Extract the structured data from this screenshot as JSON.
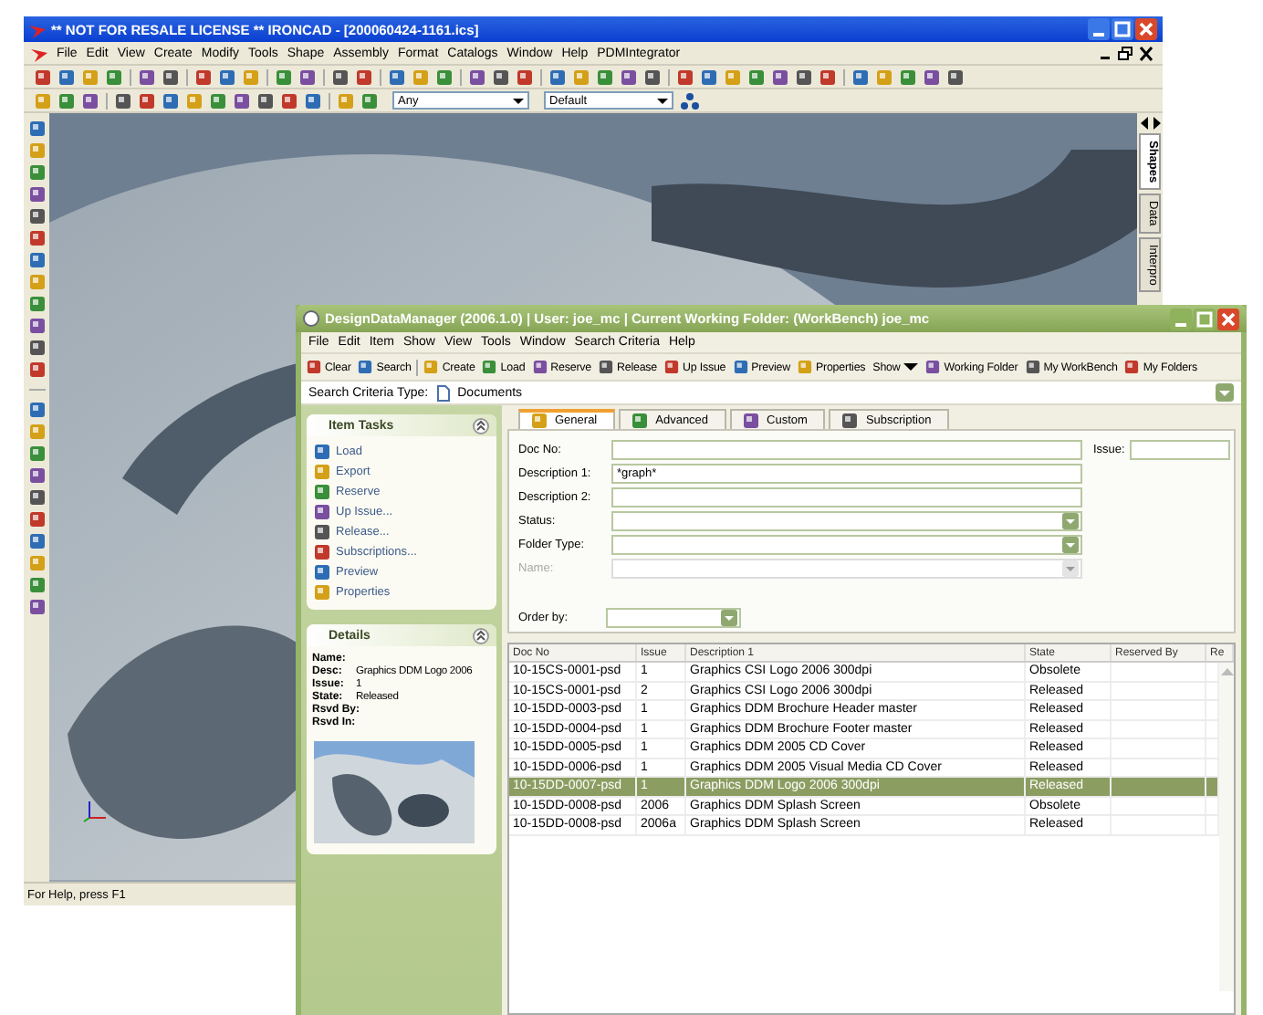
{
  "cad_window": {
    "title": "** NOT FOR RESALE LICENSE ** IRONCAD - [200060424-1161.ics]",
    "menu": [
      "File",
      "Edit",
      "View",
      "Create",
      "Modify",
      "Tools",
      "Shape",
      "Assembly",
      "Format",
      "Catalogs",
      "Window",
      "Help",
      "PDMIntegrator"
    ],
    "dropdowns": [
      {
        "value": "Any"
      },
      {
        "value": "Default"
      }
    ],
    "side_tabs": [
      {
        "label": "Shapes",
        "selected": true
      },
      {
        "label": "Data",
        "selected": false
      },
      {
        "label": "Interpro",
        "selected": false
      }
    ],
    "status_bar": "For Help, press F1"
  },
  "ddm_window": {
    "title": "DesignDataManager (2006.1.0) | User: joe_mc | Current Working Folder: (WorkBench) joe_mc",
    "menu": [
      "File",
      "Edit",
      "Item",
      "Show",
      "View",
      "Tools",
      "Window",
      "Search Criteria",
      "Help"
    ],
    "toolbar": [
      {
        "label": "Clear",
        "kind": "button"
      },
      {
        "label": "Search",
        "kind": "button"
      },
      {
        "label": "Create",
        "kind": "button"
      },
      {
        "label": "Load",
        "kind": "button"
      },
      {
        "label": "Reserve",
        "kind": "button"
      },
      {
        "label": "Release",
        "kind": "button"
      },
      {
        "label": "Up Issue",
        "kind": "button"
      },
      {
        "label": "Preview",
        "kind": "button"
      },
      {
        "label": "Properties",
        "kind": "button"
      },
      {
        "label": "Show",
        "kind": "menu"
      },
      {
        "label": "Working Folder",
        "kind": "button"
      },
      {
        "label": "My WorkBench",
        "kind": "button"
      },
      {
        "label": "My Folders",
        "kind": "button"
      }
    ],
    "search_criteria": {
      "label": "Search Criteria Type:",
      "value": "Documents"
    },
    "item_tasks": {
      "title": "Item Tasks",
      "items": [
        "Load",
        "Export",
        "Reserve",
        "Up Issue...",
        "Release...",
        "Subscriptions...",
        "Preview",
        "Properties"
      ]
    },
    "details": {
      "title": "Details",
      "fields": [
        {
          "label": "Name:"
        },
        {
          "label": "Desc:",
          "value": "Graphics DDM Logo 2006"
        },
        {
          "label": "Issue:",
          "value": "1"
        },
        {
          "label": "State:",
          "value": "Released"
        },
        {
          "label": "Rsvd By:"
        },
        {
          "label": "Rsvd In:"
        }
      ]
    },
    "tabs": [
      {
        "label": "General",
        "selected": true
      },
      {
        "label": "Advanced",
        "selected": false
      },
      {
        "label": "Custom",
        "selected": false
      },
      {
        "label": "Subscription",
        "selected": false
      }
    ],
    "form": {
      "fields": [
        {
          "label": "Doc No:",
          "kind": "text",
          "disabled": false
        },
        {
          "label": "Description 1:",
          "kind": "text",
          "value": "*graph*",
          "disabled": false
        },
        {
          "label": "Description 2:",
          "kind": "text",
          "disabled": false
        },
        {
          "label": "Status:",
          "kind": "select",
          "disabled": false
        },
        {
          "label": "Folder Type:",
          "kind": "select",
          "disabled": false
        },
        {
          "label": "Name:",
          "kind": "select",
          "disabled": true
        }
      ],
      "issue": {
        "label": "Issue:"
      },
      "order_by": {
        "label": "Order by:"
      }
    },
    "table": {
      "columns": [
        "Doc No",
        "Issue",
        "Description 1",
        "State",
        "Reserved By",
        "Re"
      ],
      "rows": [
        {
          "cells": [
            "10-15CS-0001-psd",
            "1",
            "Graphics CSI Logo 2006 300dpi",
            "Obsolete",
            ""
          ],
          "selected": false
        },
        {
          "cells": [
            "10-15CS-0001-psd",
            "2",
            "Graphics CSI Logo 2006 300dpi",
            "Released",
            ""
          ],
          "selected": false
        },
        {
          "cells": [
            "10-15DD-0003-psd",
            "1",
            "Graphics DDM Brochure Header master",
            "Released",
            ""
          ],
          "selected": false
        },
        {
          "cells": [
            "10-15DD-0004-psd",
            "1",
            "Graphics DDM Brochure Footer master",
            "Released",
            ""
          ],
          "selected": false
        },
        {
          "cells": [
            "10-15DD-0005-psd",
            "1",
            "Graphics DDM 2005 CD Cover",
            "Released",
            ""
          ],
          "selected": false
        },
        {
          "cells": [
            "10-15DD-0006-psd",
            "1",
            "Graphics DDM 2005 Visual Media CD Cover",
            "Released",
            ""
          ],
          "selected": false
        },
        {
          "cells": [
            "10-15DD-0007-psd",
            "1",
            "Graphics DDM Logo 2006 300dpi",
            "Released",
            ""
          ],
          "selected": true
        },
        {
          "cells": [
            "10-15DD-0008-psd",
            "2006",
            "Graphics DDM Splash Screen",
            "Obsolete",
            ""
          ],
          "selected": false
        },
        {
          "cells": [
            "10-15DD-0008-psd",
            "2006a",
            "Graphics DDM Splash Screen",
            "Released",
            ""
          ],
          "selected": false
        }
      ]
    }
  }
}
